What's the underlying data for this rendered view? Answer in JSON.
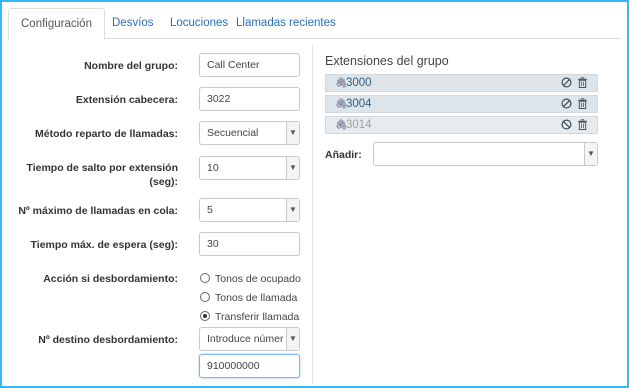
{
  "tabs": [
    {
      "label": "Configuración",
      "active": true
    },
    {
      "label": "Desvíos",
      "active": false
    },
    {
      "label": "Locuciones",
      "active": false
    },
    {
      "label": "Llamadas recientes",
      "active": false
    }
  ],
  "form": {
    "group_name": {
      "label": "Nombre del grupo:",
      "value": "Call Center"
    },
    "head_extension": {
      "label": "Extensión cabecera:",
      "value": "3022"
    },
    "distribution_method": {
      "label": "Método reparto de llamadas:",
      "value": "Secuencial"
    },
    "skip_time": {
      "label_line1": "Tiempo de salto por extensión",
      "label_line2": "(seg):",
      "value": "10"
    },
    "max_queue": {
      "label": "Nº máximo de llamadas en cola:",
      "value": "5"
    },
    "max_wait": {
      "label": "Tiempo máx. de espera (seg):",
      "value": "30"
    },
    "overflow_action": {
      "label": "Acción si desbordamiento:",
      "options": [
        "Tonos de ocupado",
        "Tonos de llamada",
        "Transferir llamada"
      ],
      "selected": "Transferir llamada"
    },
    "overflow_destination": {
      "label": "Nº destino desbordamiento:",
      "select_value": "Introduce númer",
      "value": "910000000"
    }
  },
  "extensions": {
    "title": "Extensiones del grupo",
    "items": [
      {
        "number": "3000",
        "enabled": true
      },
      {
        "number": "3004",
        "enabled": true
      },
      {
        "number": "3014",
        "enabled": false
      }
    ],
    "add_label": "Añadir:"
  },
  "colors": {
    "accent": "#36b9f0",
    "link": "#2a6fb3",
    "row_bg": "#dde5ea"
  }
}
